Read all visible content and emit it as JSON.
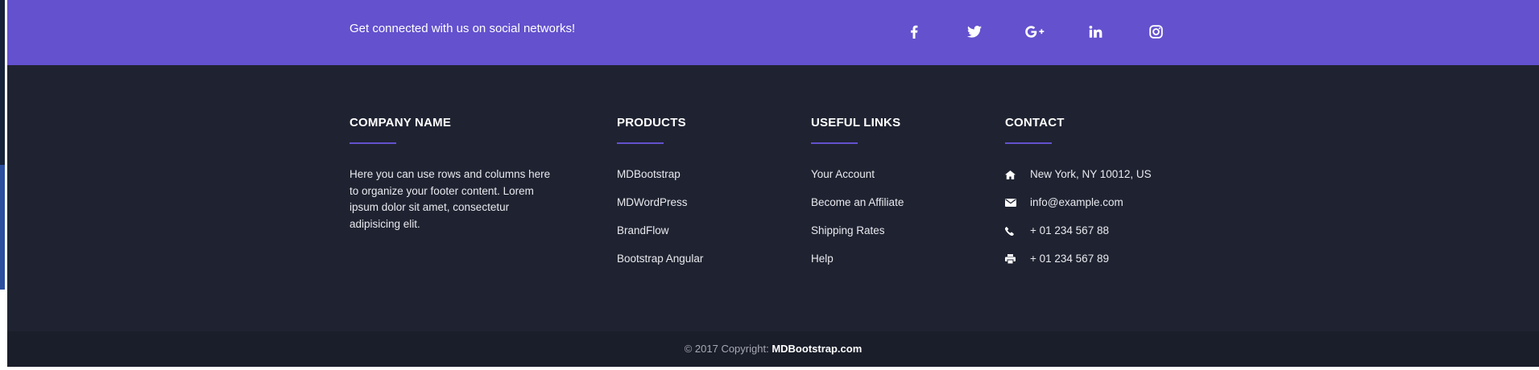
{
  "social_bar": {
    "text": "Get connected with us on social networks!",
    "icons": [
      "facebook-icon",
      "twitter-icon",
      "google-plus-icon",
      "linkedin-icon",
      "instagram-icon"
    ],
    "background": "#6351ce"
  },
  "company": {
    "heading": "COMPANY NAME",
    "text": "Here you can use rows and columns here to organize your footer content. Lorem ipsum dolor sit amet, consectetur adipisicing elit."
  },
  "products": {
    "heading": "PRODUCTS",
    "items": [
      "MDBootstrap",
      "MDWordPress",
      "BrandFlow",
      "Bootstrap Angular"
    ]
  },
  "useful_links": {
    "heading": "USEFUL LINKS",
    "items": [
      "Your Account",
      "Become an Affiliate",
      "Shipping Rates",
      "Help"
    ]
  },
  "contact": {
    "heading": "CONTACT",
    "items": [
      {
        "icon": "home-icon",
        "text": "New York, NY 10012, US"
      },
      {
        "icon": "envelope-icon",
        "text": "info@example.com"
      },
      {
        "icon": "phone-icon",
        "text": "+ 01 234 567 88"
      },
      {
        "icon": "print-icon",
        "text": "+ 01 234 567 89"
      }
    ]
  },
  "copyright": {
    "prefix": "© 2017 Copyright:",
    "brand": "MDBootstrap.com"
  },
  "colors": {
    "footer_bg": "#1f2331",
    "copyright_bg": "#1a1e2a",
    "accent": "#6351ce"
  }
}
